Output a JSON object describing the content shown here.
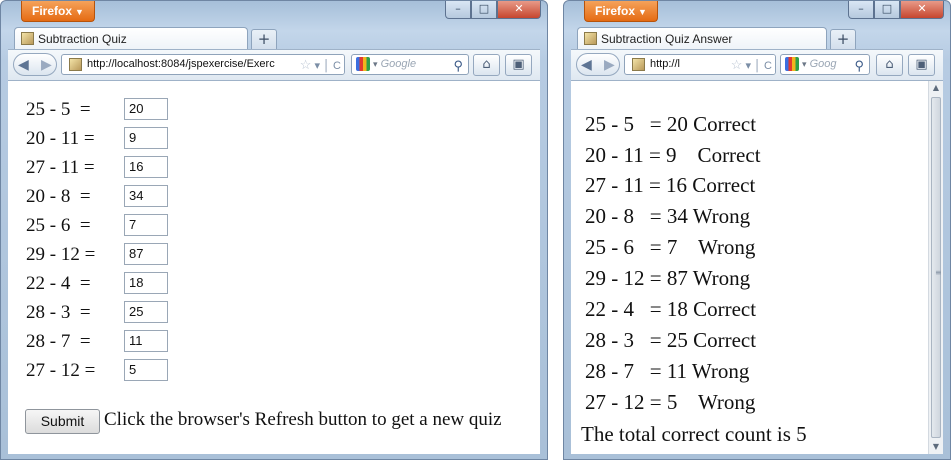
{
  "window1": {
    "app_button": "Firefox",
    "tab_title": "Subtraction Quiz",
    "url": "http://localhost:8084/jspexercise/Exerc",
    "search_placeholder": "Google",
    "new_tab": "+",
    "questions": [
      {
        "expr": "25 - 5  =",
        "answer": "20"
      },
      {
        "expr": "20 - 11 =",
        "answer": "9"
      },
      {
        "expr": "27 - 11 =",
        "answer": "16"
      },
      {
        "expr": "20 - 8  =",
        "answer": "34"
      },
      {
        "expr": "25 - 6  =",
        "answer": "7"
      },
      {
        "expr": "29 - 12 =",
        "answer": "87"
      },
      {
        "expr": "22 - 4  =",
        "answer": "18"
      },
      {
        "expr": "28 - 3  =",
        "answer": "25"
      },
      {
        "expr": "28 - 7  =",
        "answer": "11"
      },
      {
        "expr": "27 - 12 =",
        "answer": "5"
      }
    ],
    "submit_label": "Submit",
    "hint": "Click the browser's Refresh button to get a new quiz"
  },
  "window2": {
    "app_button": "Firefox",
    "tab_title": "Subtraction Quiz Answer",
    "url": "http://l",
    "search_placeholder": "Goog",
    "new_tab": "+",
    "results": [
      "25 - 5   = 20 Correct",
      "20 - 11 = 9    Correct",
      "27 - 11 = 16 Correct",
      "20 - 8   = 34 Wrong",
      "25 - 6   = 7    Wrong",
      "29 - 12 = 87 Wrong",
      "22 - 4   = 18 Correct",
      "28 - 3   = 25 Correct",
      "28 - 7   = 11 Wrong",
      "27 - 12 = 5    Wrong"
    ],
    "total": "The total correct count is 5"
  },
  "icons": {
    "back": "◀",
    "forward": "▶",
    "reload": "C",
    "home": "⌂",
    "star": "☆",
    "search": "⚲"
  },
  "colors": {
    "chrome": "#b6cbe2",
    "firefox_orange": "#e56b13",
    "close_red": "#c6462f"
  }
}
